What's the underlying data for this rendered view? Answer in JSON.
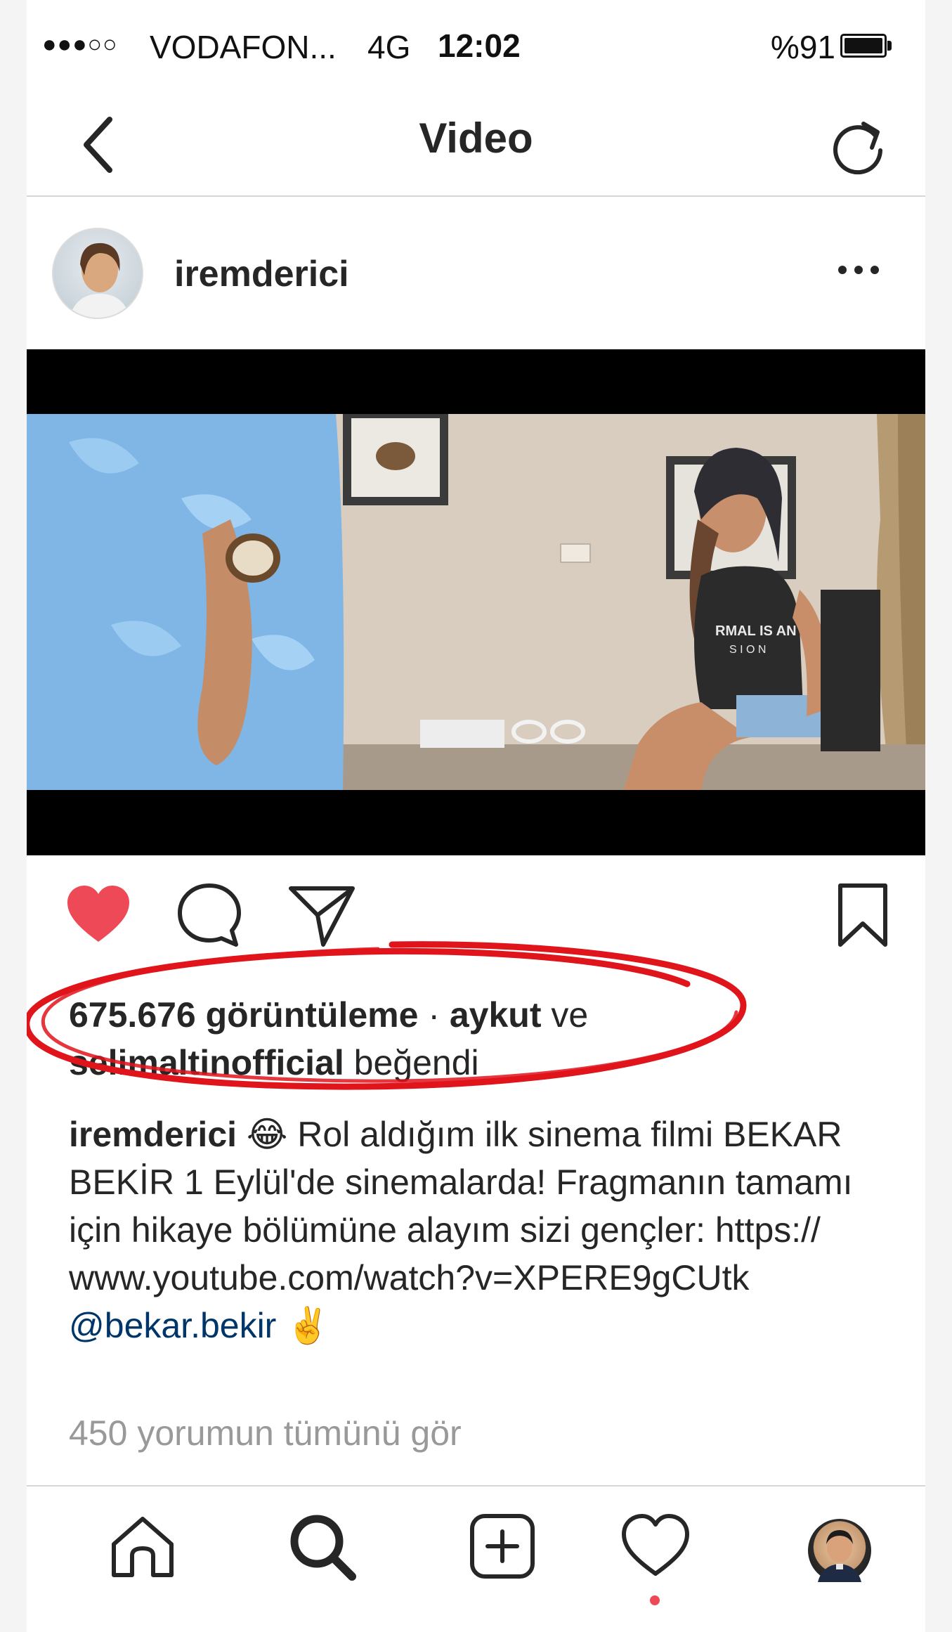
{
  "status_bar": {
    "signal": "●●●○○",
    "carrier": "VODAFON...",
    "network": "4G",
    "time": "12:02",
    "battery": "%91"
  },
  "header": {
    "title": "Video",
    "back_icon": "chevron-left-icon",
    "refresh_icon": "refresh-icon"
  },
  "post": {
    "username": "iremderici",
    "more_icon": "more-dots-icon"
  },
  "video": {
    "shirt_text": "RMAL IS AN\nS I O N"
  },
  "actions": {
    "like_icon": "heart-filled-icon",
    "comment_icon": "comment-icon",
    "share_icon": "send-icon",
    "save_icon": "bookmark-icon",
    "like_color": "#ed4956"
  },
  "likes": {
    "views": "675.676 görüntüleme",
    "separator": " · ",
    "user1": "aykut",
    "conj": " ve",
    "user2": "selimaltinofficial",
    "suffix": " beğendi"
  },
  "caption": {
    "username": "iremderici",
    "emoji": "😂",
    "text": " Rol aldığım ilk sinema filmi BEKAR BEKİR 1 Eylül'de sinemalarda! Fragmanın tamamı için hikaye bölümüne alayım sizi gençler: https:// www.youtube.com/watch?v=XPERE9gCUtk",
    "mention": "@bekar.bekir",
    "emoji2": "✌️"
  },
  "comments": {
    "view_all": "450 yorumun tümünü gör"
  },
  "tab_bar": {
    "items": [
      "home-icon",
      "search-icon",
      "add-post-icon",
      "activity-heart-icon",
      "profile-avatar"
    ],
    "notification_dot_color": "#ed4956"
  },
  "annotation": {
    "oval_color": "#e0141b"
  }
}
